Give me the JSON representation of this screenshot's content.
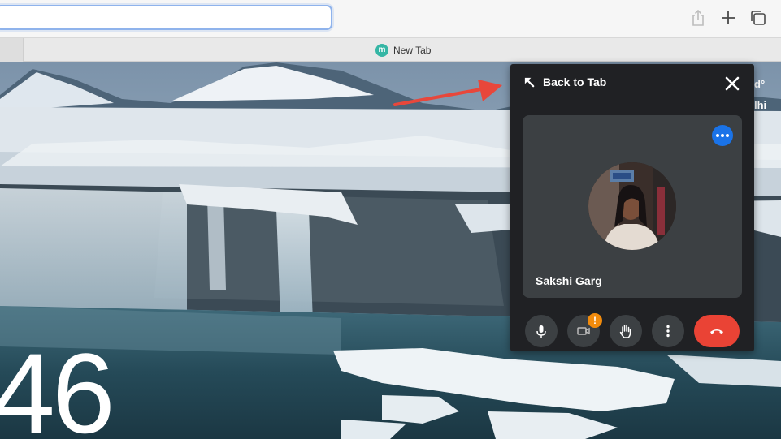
{
  "browser": {
    "address_value": "",
    "tab_title": "New Tab",
    "favicon_letter": "m",
    "favicon_color": "#35b6a5",
    "toolbar_icons": [
      "share-icon",
      "plus-icon",
      "tabs-overview-icon"
    ]
  },
  "new_tab_page": {
    "clock_text": "46",
    "weather_peek_lines": [
      "d°",
      "lhi"
    ]
  },
  "pip_window": {
    "back_to_tab_label": "Back to Tab",
    "participant_name": "Sakshi Garg",
    "camera_warning_badge": "!",
    "controls": [
      "mic-icon",
      "camera-icon",
      "raise-hand-icon",
      "more-options-icon",
      "end-call-icon"
    ],
    "colors": {
      "panel": "#202124",
      "tile": "#3c4043",
      "accent_blue": "#1a73e8",
      "end_call_red": "#ea4335",
      "warning_orange": "#f28b0c"
    }
  },
  "annotation": {
    "arrow_color": "#e8473b"
  }
}
